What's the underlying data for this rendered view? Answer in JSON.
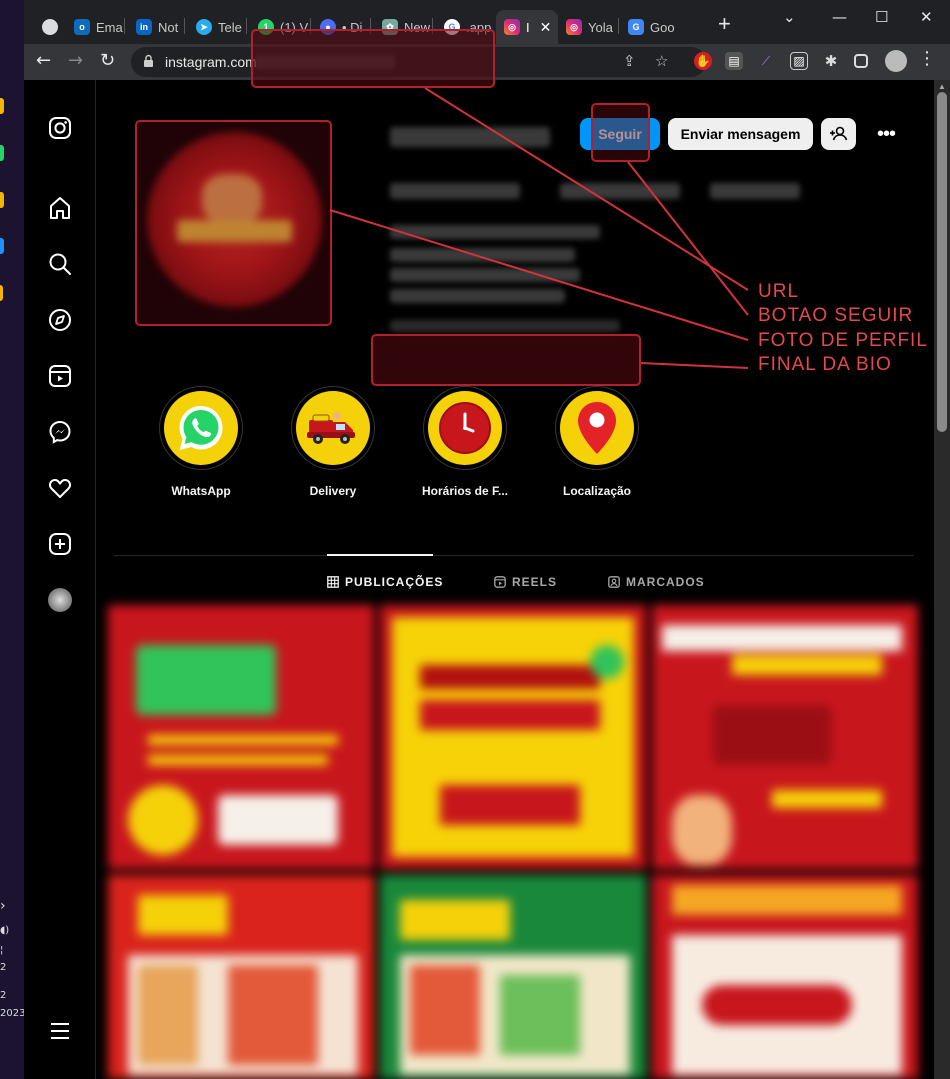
{
  "browser": {
    "tabs": [
      {
        "label": "",
        "fav": "chrome-circle-icon",
        "color": "#dadce0"
      },
      {
        "label": "Ema",
        "fav": "outlook-icon",
        "color": "#0f6cbd"
      },
      {
        "label": "Not",
        "fav": "linkedin-icon",
        "color": "#0a66c2"
      },
      {
        "label": "Tele",
        "fav": "telegram-icon",
        "color": "#2aabee"
      },
      {
        "label": "(1) V",
        "fav": "whatsapp-icon",
        "color": "#25d366"
      },
      {
        "label": "• Di",
        "fav": "record-icon",
        "color": "#4a6cf7"
      },
      {
        "label": "New",
        "fav": "chatgpt-icon",
        "color": "#74aa9c"
      },
      {
        "label": ".app",
        "fav": "google-icon",
        "color": "#ffffff"
      },
      {
        "label": "I",
        "fav": "instagram-icon",
        "color": "#e1306c"
      },
      {
        "label": "Yola",
        "fav": "instagram-icon",
        "color": "#e1306c"
      },
      {
        "label": "Goo",
        "fav": "google-translate-icon",
        "color": "#4285f4"
      }
    ],
    "url": "instagram.com",
    "window_controls": {
      "minimize": "—",
      "maximize": "☐",
      "close": "✕"
    }
  },
  "profile": {
    "follow_button": "Seguir",
    "message_button": "Enviar mensagem"
  },
  "highlights": [
    {
      "label": "WhatsApp",
      "icon": "whatsapp-icon"
    },
    {
      "label": "Delivery",
      "icon": "delivery-truck-icon"
    },
    {
      "label": "Horários de F...",
      "icon": "clock-icon"
    },
    {
      "label": "Localização",
      "icon": "location-pin-icon"
    }
  ],
  "profile_tabs": [
    {
      "label": "PUBLICAÇÕES",
      "icon": "grid-icon",
      "active": true
    },
    {
      "label": "REELS",
      "icon": "reels-icon",
      "active": false
    },
    {
      "label": "MARCADOS",
      "icon": "tagged-icon",
      "active": false
    }
  ],
  "annotations": {
    "url": "URL",
    "follow": "BOTAO SEGUIR",
    "photo": "FOTO DE PERFIL",
    "bio_end": "FINAL DA BIO",
    "color": "#e34a4a"
  },
  "desktop": {
    "taskbar_text": [
      "2",
      "2",
      "2023"
    ]
  },
  "theme": {
    "accent": "#0095f6",
    "highlight_bg": "#f5d10a",
    "post_red": "#c8161d"
  }
}
